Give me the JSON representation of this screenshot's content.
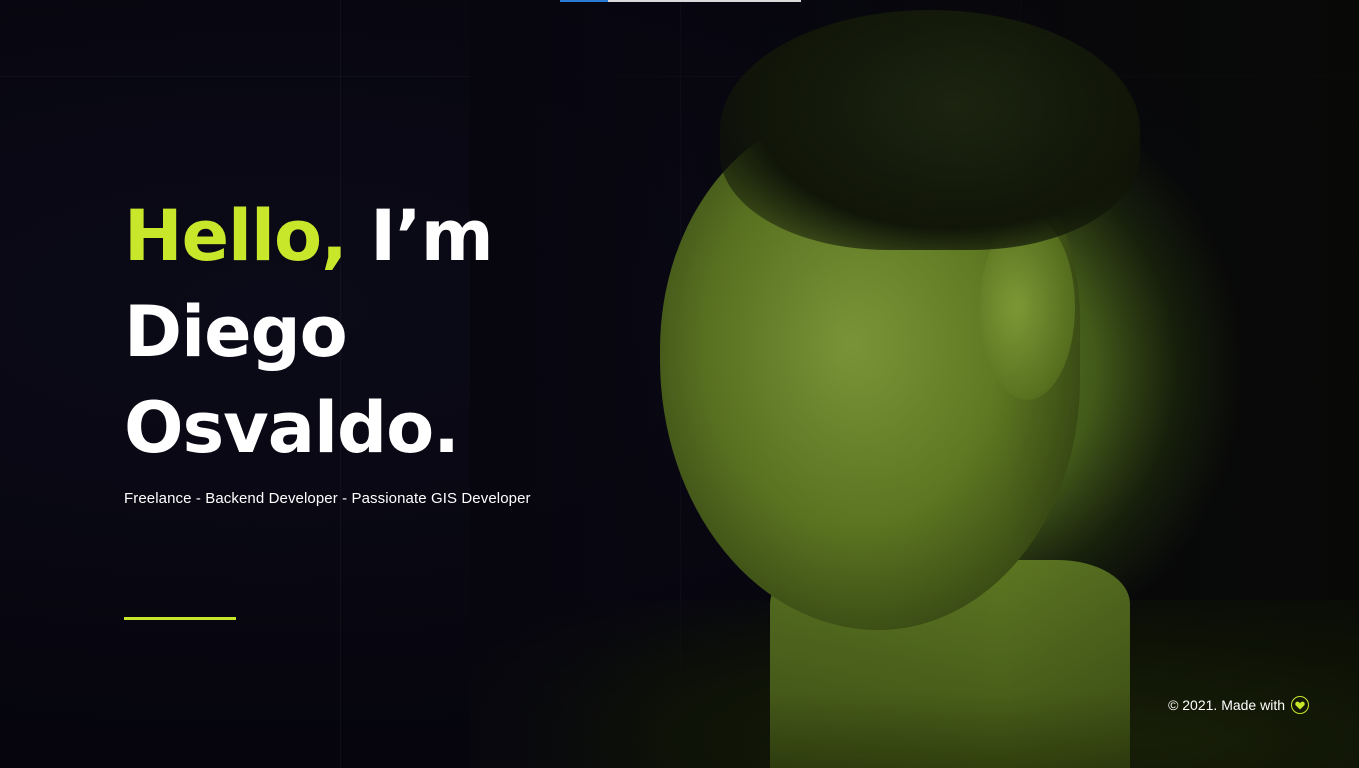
{
  "top_progress": {
    "fill_fraction": 0.2,
    "fill_color": "#2a7bd6",
    "track_color": "#ffffff"
  },
  "colors": {
    "accent": "#c8e62a",
    "background": "#07060f",
    "text": "#ffffff"
  },
  "hero": {
    "greeting": "Hello,",
    "intro": "I’m",
    "first_name": "Diego",
    "last_name": "Osvaldo.",
    "subtitle": "Freelance - Backend Developer - Passionate GIS Developer"
  },
  "footer": {
    "copyright": "© 2021. Made with",
    "icon": "heart-icon"
  }
}
